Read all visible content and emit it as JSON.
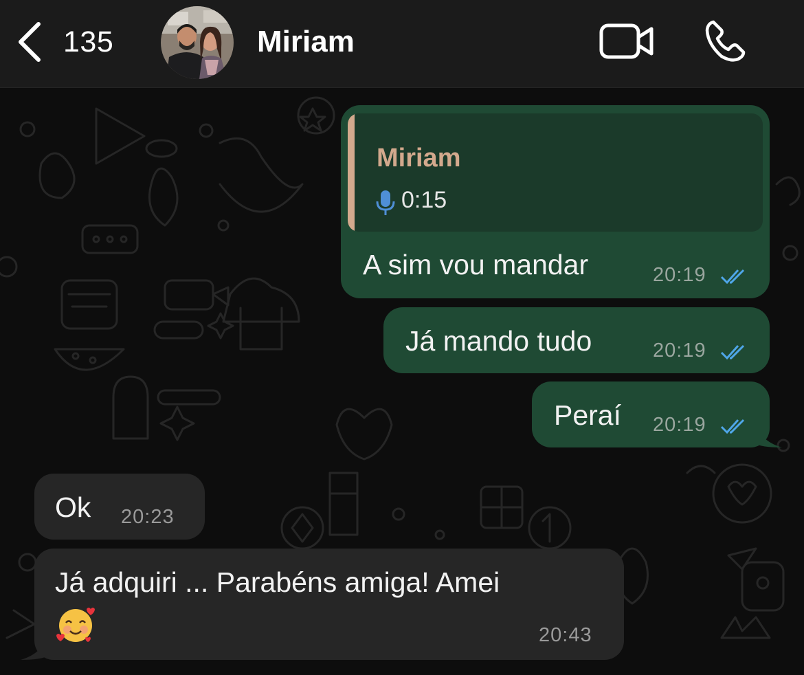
{
  "header": {
    "back_count": "135",
    "contact_name": "Miriam"
  },
  "colors": {
    "outgoing_bubble": "#1f4a34",
    "incoming_bubble": "#262626",
    "read_ticks": "#4fa6e8",
    "quote_accent": "#d3a98d"
  },
  "icons": {
    "back": "chevron-left-icon",
    "video": "video-camera-icon",
    "phone": "phone-icon",
    "mic": "microphone-icon",
    "read": "double-check-icon"
  },
  "messages": [
    {
      "direction": "outgoing",
      "quote": {
        "author": "Miriam",
        "duration": "0:15"
      },
      "text": "A sim vou mandar",
      "time": "20:19",
      "status": "read"
    },
    {
      "direction": "outgoing",
      "text": "Já mando tudo",
      "time": "20:19",
      "status": "read"
    },
    {
      "direction": "outgoing",
      "text": "Peraí",
      "time": "20:19",
      "status": "read"
    },
    {
      "direction": "incoming",
      "text": "Ok",
      "time": "20:23"
    },
    {
      "direction": "incoming",
      "text": "Já adquiri ... Parabéns amiga! Amei",
      "emoji": "smiling-face-with-hearts",
      "time": "20:43"
    }
  ]
}
